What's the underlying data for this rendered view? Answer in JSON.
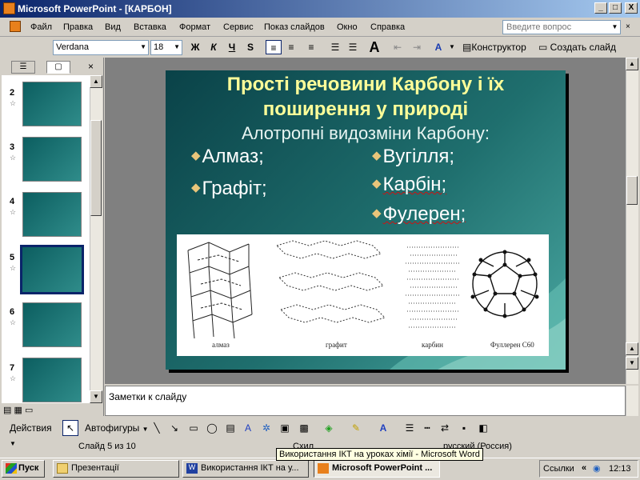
{
  "window": {
    "title": "Microsoft PowerPoint - [КАРБОН]",
    "min": "_",
    "max": "□",
    "close": "X"
  },
  "menu": {
    "items": [
      "Файл",
      "Правка",
      "Вид",
      "Вставка",
      "Формат",
      "Сервис",
      "Показ слайдов",
      "Окно",
      "Справка"
    ],
    "ask_placeholder": "Введите вопрос"
  },
  "toolbar": {
    "font": "Verdana",
    "size": "18",
    "bold": "Ж",
    "italic": "К",
    "underline": "Ч",
    "shadow": "S",
    "design": "Конструктор",
    "new_slide": "Создать слайд"
  },
  "thumbs": {
    "numbers": [
      "2",
      "3",
      "4",
      "5",
      "6",
      "7"
    ],
    "selected": "5"
  },
  "slide": {
    "title_line1": "Прості речовини Карбону і їх",
    "title_line2": "поширення у природі",
    "subtitle": "Алотропні видозміни Карбону:",
    "left_bullets": [
      "Алмаз;",
      "Графіт;"
    ],
    "right_bullets": [
      "Вугілля;",
      "Карбін;",
      "Фулерен;"
    ],
    "image_labels": [
      "алмаз",
      "графит",
      "карбин",
      "Фуллерен C60"
    ]
  },
  "notes": {
    "placeholder": "Заметки к слайду"
  },
  "drawing": {
    "actions": "Действия",
    "autoshapes": "Автофигуры"
  },
  "status": {
    "slide": "Слайд 5 из 10",
    "design": "Схил",
    "language": "русский (Россия)"
  },
  "tooltip": "Використання ІКТ на уроках хімії - Microsoft Word",
  "taskbar": {
    "start": "Пуск",
    "buttons": [
      "Презентації",
      "Використання ІКТ на у...",
      "Microsoft PowerPoint ..."
    ],
    "links": "Ссылки",
    "time": "12:13"
  }
}
